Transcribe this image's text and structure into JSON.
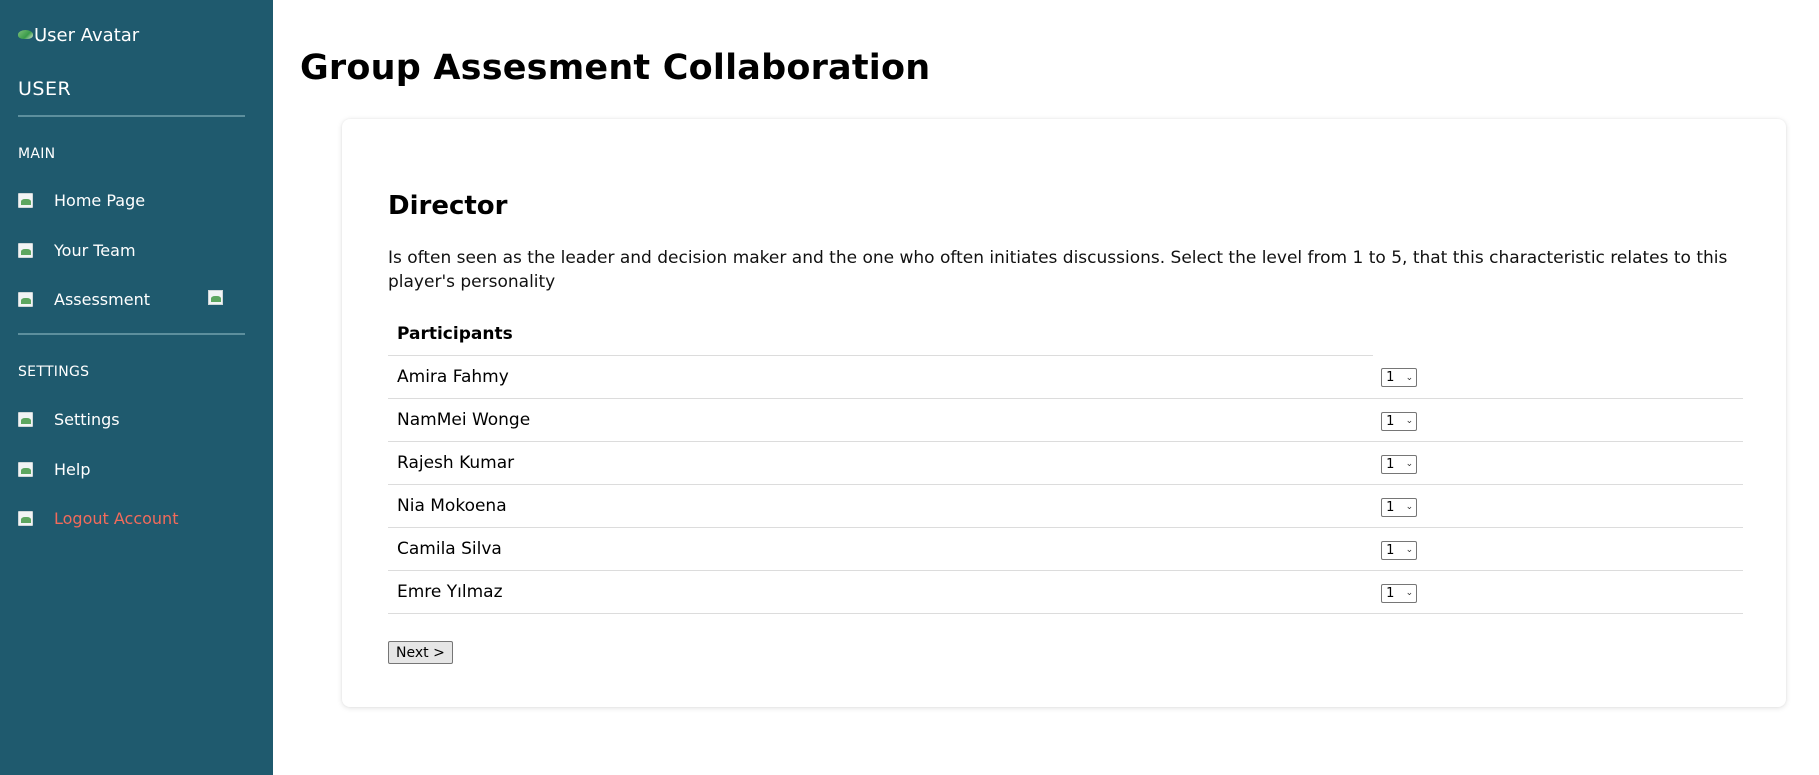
{
  "sidebar": {
    "avatar_alt": "User Avatar",
    "user_label": "USER",
    "main_label": "MAIN",
    "main_items": [
      {
        "label": "Home Page",
        "icon": "home-icon"
      },
      {
        "label": "Your Team",
        "icon": "team-icon"
      },
      {
        "label": "Assessment",
        "icon": "assessment-icon"
      }
    ],
    "settings_label": "SETTINGS",
    "settings_items": [
      {
        "label": "Settings",
        "icon": "settings-icon"
      },
      {
        "label": "Help",
        "icon": "help-icon"
      },
      {
        "label": "Logout Account",
        "icon": "logout-icon"
      }
    ]
  },
  "main": {
    "title": "Group Assesment Collaboration",
    "card": {
      "heading": "Director",
      "description": "Is often seen as the leader and decision maker and the one who often initiates discussions. Select the level from 1 to 5, that this characteristic relates to this player's personality",
      "table_header": "Participants",
      "participants": [
        {
          "name": "Amira Fahmy",
          "level": "1"
        },
        {
          "name": "NamMei Wonge",
          "level": "1"
        },
        {
          "name": "Rajesh Kumar",
          "level": "1"
        },
        {
          "name": "Nia Mokoena",
          "level": "1"
        },
        {
          "name": "Camila Silva",
          "level": "1"
        },
        {
          "name": "Emre Yılmaz",
          "level": "1"
        }
      ],
      "next_label": "Next >"
    }
  },
  "colors": {
    "sidebar_bg": "#1f5a6e",
    "logout_text": "#f26b5b"
  }
}
